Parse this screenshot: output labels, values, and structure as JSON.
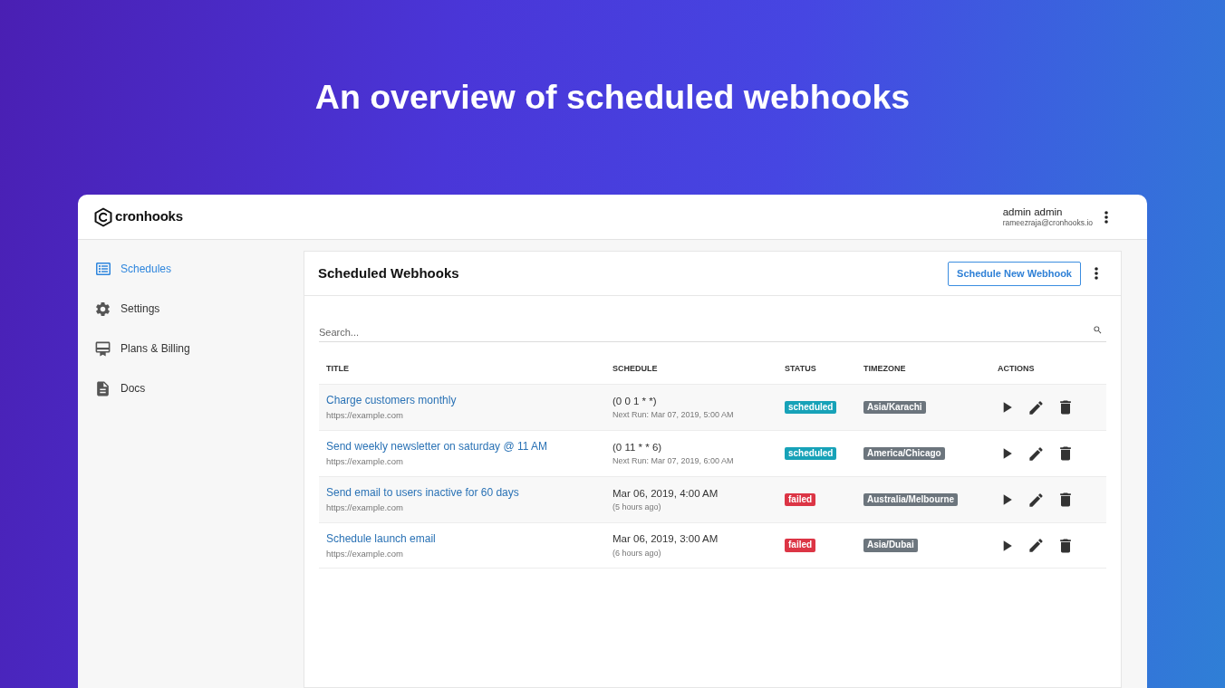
{
  "headline": "An overview of scheduled webhooks",
  "topbar": {
    "logo": "cronhooks",
    "user_name": "admin admin",
    "user_email": "rameezraja@cronhooks.io"
  },
  "sidebar": {
    "items": [
      {
        "label": "Schedules",
        "selected": true
      },
      {
        "label": "Settings",
        "selected": false
      },
      {
        "label": "Plans & Billing",
        "selected": false
      },
      {
        "label": "Docs",
        "selected": false
      }
    ]
  },
  "panel": {
    "title": "Scheduled Webhooks",
    "button": "Schedule New Webhook",
    "search": {
      "placeholder": "Search..."
    },
    "table": {
      "columns": [
        "TITLE",
        "SCHEDULE",
        "STATUS",
        "TIMEZONE",
        "ACTIONS"
      ],
      "rows": [
        {
          "title": "Charge customers monthly",
          "url": "https://example.com",
          "schedule": "(0 0 1 * *)",
          "schedule_detail": "Next Run: Mar 07, 2019, 5:00 AM",
          "status": {
            "label": "scheduled",
            "color": "#17a2b8"
          },
          "timezone": "Asia/Karachi"
        },
        {
          "title": "Send weekly newsletter on saturday @ 11 AM",
          "url": "https://example.com",
          "schedule": "(0 11 * * 6)",
          "schedule_detail": "Next Run: Mar 07, 2019, 6:00 AM",
          "status": {
            "label": "scheduled",
            "color": "#17a2b8"
          },
          "timezone": "America/Chicago"
        },
        {
          "title": "Send email to users inactive for 60 days",
          "url": "https://example.com",
          "schedule": "Mar 06, 2019, 4:00 AM",
          "schedule_detail": "(5 hours ago)",
          "status": {
            "label": "failed",
            "color": "#dc3545"
          },
          "timezone": "Australia/Melbourne"
        },
        {
          "title": "Schedule launch email",
          "url": "https://example.com",
          "schedule": "Mar 06, 2019, 3:00 AM",
          "schedule_detail": "(6 hours ago)",
          "status": {
            "label": "failed",
            "color": "#dc3545"
          },
          "timezone": "Asia/Dubai"
        }
      ]
    }
  }
}
